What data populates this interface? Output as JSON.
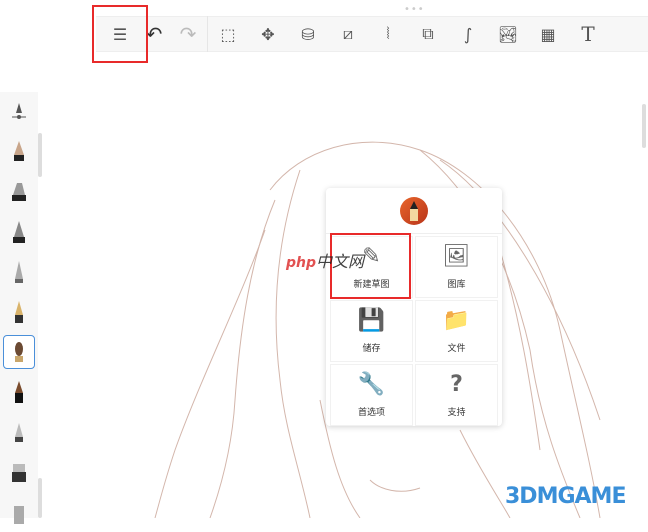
{
  "toolbar": {
    "handle": "•••",
    "items": [
      {
        "name": "brush-list-icon",
        "glyph": "☰"
      },
      {
        "name": "undo-icon",
        "glyph": "↶"
      },
      {
        "name": "redo-icon",
        "glyph": "↷"
      },
      {
        "name": "selection-icon",
        "glyph": "⬚"
      },
      {
        "name": "transform-icon",
        "glyph": "✥"
      },
      {
        "name": "fill-icon",
        "glyph": "⛁"
      },
      {
        "name": "ruler-icon",
        "glyph": "⧄"
      },
      {
        "name": "symmetry-icon",
        "glyph": "⦚"
      },
      {
        "name": "shapes-icon",
        "glyph": "⧉"
      },
      {
        "name": "curve-icon",
        "glyph": "∫"
      },
      {
        "name": "import-image-icon",
        "glyph": "🏞"
      },
      {
        "name": "perspective-icon",
        "glyph": "▦"
      },
      {
        "name": "text-icon",
        "glyph": "T"
      }
    ]
  },
  "menu": {
    "items": [
      {
        "label": "新建草图",
        "icon": "✎",
        "name": "new-sketch"
      },
      {
        "label": "图库",
        "icon": "🖼",
        "name": "gallery"
      },
      {
        "label": "储存",
        "icon": "💾",
        "name": "save"
      },
      {
        "label": "文件",
        "icon": "📁",
        "name": "files"
      },
      {
        "label": "首选项",
        "icon": "🔧",
        "name": "preferences"
      },
      {
        "label": "支持",
        "icon": "?",
        "name": "support"
      }
    ]
  },
  "watermarks": {
    "php": "php",
    "php_cn": "中文网",
    "game": "3DMGAME"
  },
  "colors": {
    "highlight": "#e82a2a",
    "selected": "#4a8fd9"
  }
}
